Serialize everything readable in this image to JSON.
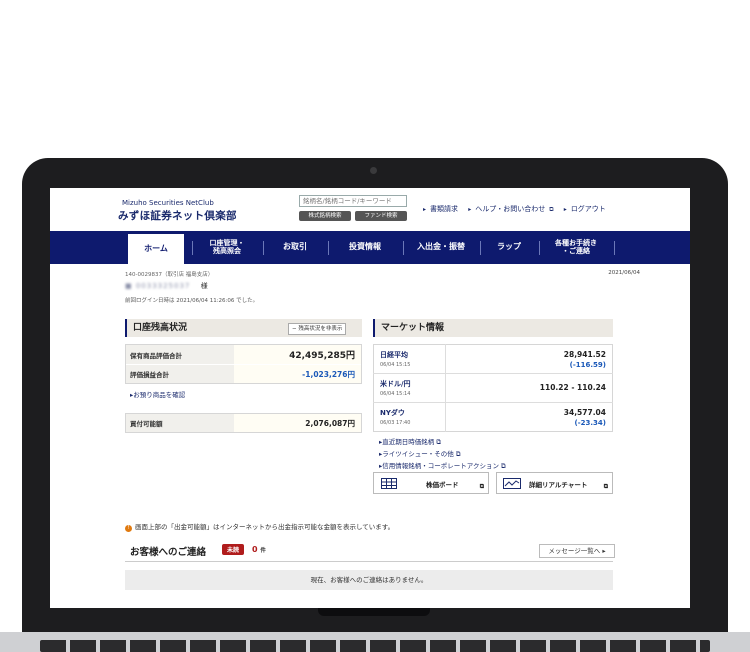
{
  "header": {
    "logo_en": "Mizuho Securities NetClub",
    "logo_jp": "みずほ証券ネット倶楽部",
    "search_placeholder": "銘柄名/銘柄コード/キーワード",
    "btn_stock_search": "株式銘柄検索",
    "btn_fund_search": "ファンド検索",
    "link_documents": "書類請求",
    "link_help": "ヘルプ・お問い合わせ",
    "link_logout": "ログアウト"
  },
  "nav": {
    "items": [
      {
        "label": "ホーム"
      },
      {
        "label": "口座管理・\n残高照会"
      },
      {
        "label": "お取引"
      },
      {
        "label": "投資情報"
      },
      {
        "label": "入出金・振替"
      },
      {
        "label": "ラップ"
      },
      {
        "label": "各種お手続き\n・ご連絡"
      }
    ]
  },
  "account": {
    "id_line": "140-0029837（取引店 福島支店）",
    "name_masked": "■ 0033325037",
    "honorific": "様",
    "date": "2021/06/04",
    "last_login": "前回ログイン日時は 2021/06/04 11:26:06 でした。"
  },
  "balance": {
    "title": "口座残高状況",
    "hide_button": "残高状況を非表示",
    "rows": [
      {
        "label": "保有商品評価合計",
        "value": "42,495,285円"
      },
      {
        "label": "評価損益合計",
        "value": "-1,023,276円"
      }
    ],
    "link_check": "お預り商品を確認",
    "buying_power_label": "買付可能額",
    "buying_power_value": "2,076,087円"
  },
  "market": {
    "title": "マーケット情報",
    "rows": [
      {
        "label": "日経平均",
        "time": "06/04 15:15",
        "value": "28,941.52",
        "change": "(-116.59)"
      },
      {
        "label": "米ドル/円",
        "time": "06/04 15:14",
        "value": "110.22 - 110.24",
        "change": ""
      },
      {
        "label": "NYダウ",
        "time": "06/03 17:40",
        "value": "34,577.04",
        "change": "(-23.34)"
      }
    ],
    "links": [
      "直近期日時価銘柄",
      "ライツイシュー・その他",
      "信用情報銘柄・コーポレートアクション"
    ],
    "btn_board": "株価ボード",
    "btn_chart": "詳細リアルチャート"
  },
  "note": "画面上部の「出金可能額」はインターネットから出金指示可能な金額を表示しています。",
  "contact": {
    "title": "お客様へのご連絡",
    "unread_label": "未読",
    "unread_count": "0",
    "unread_unit": "件",
    "message_button": "メッセージ一覧へ",
    "empty_text": "現在、お客様へのご連絡はありません。"
  }
}
